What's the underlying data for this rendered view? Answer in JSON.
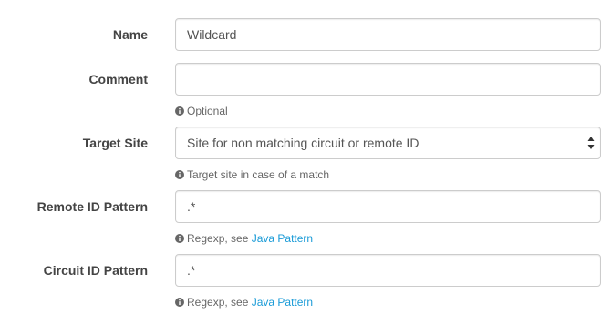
{
  "fields": {
    "name": {
      "label": "Name",
      "value": "Wildcard",
      "placeholder": ""
    },
    "comment": {
      "label": "Comment",
      "value": "",
      "placeholder": "",
      "help": "Optional"
    },
    "target_site": {
      "label": "Target Site",
      "selected": "Site for non matching circuit or remote ID",
      "help": "Target site in case of a match"
    },
    "remote_id_pattern": {
      "label": "Remote ID Pattern",
      "value": ".*",
      "help_prefix": "Regexp, see ",
      "help_link": "Java Pattern"
    },
    "circuit_id_pattern": {
      "label": "Circuit ID Pattern",
      "value": ".*",
      "help_prefix": "Regexp, see ",
      "help_link": "Java Pattern"
    }
  },
  "icons": {
    "help": "info-circle-icon",
    "select": "updown-arrows-icon"
  },
  "colors": {
    "label": "#444444",
    "border": "#cccccc",
    "help_text": "#666666",
    "link": "#1a9bd7"
  }
}
